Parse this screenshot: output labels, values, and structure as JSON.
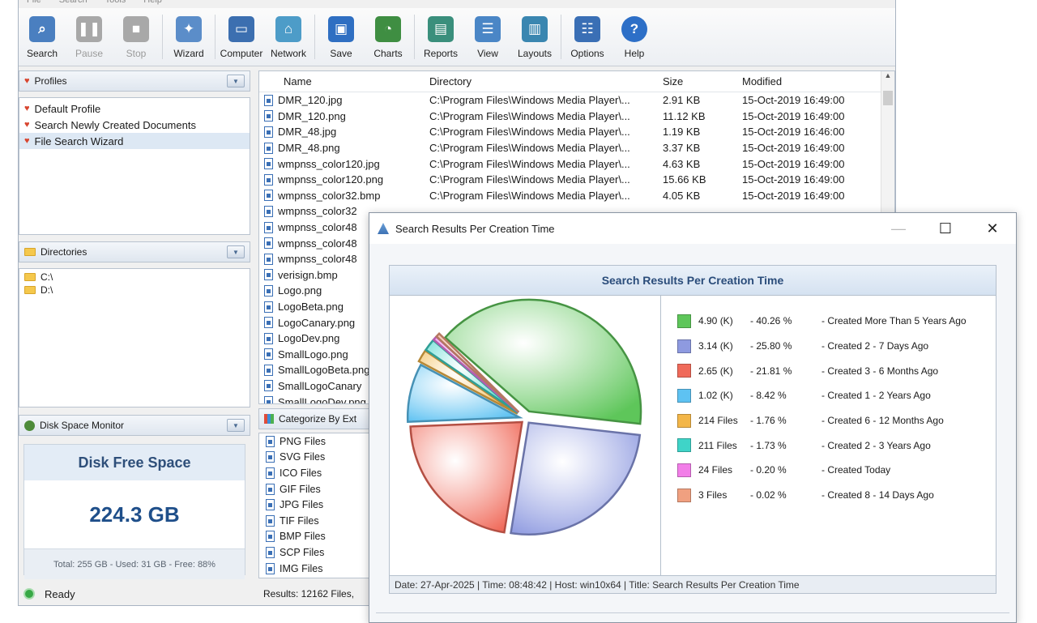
{
  "menu": [
    "File",
    "Search",
    "Tools",
    "Help"
  ],
  "toolbar": [
    {
      "label": "Search",
      "icon": "search-icon",
      "enabled": true
    },
    {
      "label": "Pause",
      "icon": "pause-icon",
      "enabled": false
    },
    {
      "label": "Stop",
      "icon": "stop-icon",
      "enabled": false
    },
    {
      "label": "Wizard",
      "icon": "wizard-icon",
      "enabled": true
    },
    {
      "label": "Computer",
      "icon": "computer-icon",
      "enabled": true
    },
    {
      "label": "Network",
      "icon": "network-icon",
      "enabled": true
    },
    {
      "label": "Save",
      "icon": "save-icon",
      "enabled": true
    },
    {
      "label": "Charts",
      "icon": "charts-icon",
      "enabled": true
    },
    {
      "label": "Reports",
      "icon": "reports-icon",
      "enabled": true
    },
    {
      "label": "View",
      "icon": "view-icon",
      "enabled": true
    },
    {
      "label": "Layouts",
      "icon": "layouts-icon",
      "enabled": true
    },
    {
      "label": "Options",
      "icon": "options-icon",
      "enabled": true
    },
    {
      "label": "Help",
      "icon": "help-icon",
      "enabled": true
    }
  ],
  "profiles": {
    "title": "Profiles",
    "items": [
      {
        "label": "Default Profile",
        "selected": false
      },
      {
        "label": "Search Newly Created Documents",
        "selected": false
      },
      {
        "label": "File Search Wizard",
        "selected": true
      }
    ]
  },
  "directories": {
    "title": "Directories",
    "items": [
      "C:\\",
      "D:\\"
    ]
  },
  "disk": {
    "panel_title": "Disk Space Monitor",
    "title": "Disk Free Space",
    "value": "224.3 GB",
    "footer": "Total: 255 GB - Used: 31 GB - Free: 88%"
  },
  "results": {
    "columns": [
      "Name",
      "Directory",
      "Size",
      "Modified"
    ],
    "rows": [
      [
        "DMR_120.jpg",
        "C:\\Program Files\\Windows Media Player\\...",
        "2.91 KB",
        "15-Oct-2019 16:49:00"
      ],
      [
        "DMR_120.png",
        "C:\\Program Files\\Windows Media Player\\...",
        "11.12 KB",
        "15-Oct-2019 16:49:00"
      ],
      [
        "DMR_48.jpg",
        "C:\\Program Files\\Windows Media Player\\...",
        "1.19 KB",
        "15-Oct-2019 16:46:00"
      ],
      [
        "DMR_48.png",
        "C:\\Program Files\\Windows Media Player\\...",
        "3.37 KB",
        "15-Oct-2019 16:49:00"
      ],
      [
        "wmpnss_color120.jpg",
        "C:\\Program Files\\Windows Media Player\\...",
        "4.63 KB",
        "15-Oct-2019 16:49:00"
      ],
      [
        "wmpnss_color120.png",
        "C:\\Program Files\\Windows Media Player\\...",
        "15.66 KB",
        "15-Oct-2019 16:49:00"
      ],
      [
        "wmpnss_color32.bmp",
        "C:\\Program Files\\Windows Media Player\\...",
        "4.05 KB",
        "15-Oct-2019 16:49:00"
      ],
      [
        "wmpnss_color32",
        "",
        "",
        ""
      ],
      [
        "wmpnss_color48",
        "",
        "",
        ""
      ],
      [
        "wmpnss_color48",
        "",
        "",
        ""
      ],
      [
        "wmpnss_color48",
        "",
        "",
        ""
      ],
      [
        "verisign.bmp",
        "",
        "",
        ""
      ],
      [
        "Logo.png",
        "",
        "",
        ""
      ],
      [
        "LogoBeta.png",
        "",
        "",
        ""
      ],
      [
        "LogoCanary.png",
        "",
        "",
        ""
      ],
      [
        "LogoDev.png",
        "",
        "",
        ""
      ],
      [
        "SmallLogo.png",
        "",
        "",
        ""
      ],
      [
        "SmallLogoBeta.png",
        "",
        "",
        ""
      ],
      [
        "SmallLogoCanary",
        "",
        "",
        ""
      ],
      [
        "SmallLogoDev.png",
        "",
        "",
        ""
      ]
    ]
  },
  "categorize": {
    "title": "Categorize By Ext",
    "items": [
      "PNG Files",
      "SVG Files",
      "ICO Files",
      "GIF Files",
      "JPG Files",
      "TIF Files",
      "BMP Files",
      "SCP Files",
      "IMG Files"
    ]
  },
  "status": {
    "text": "Ready",
    "results": "Results: 12162 Files,"
  },
  "dialog": {
    "title": "Search Results Per Creation Time",
    "minimize": "—",
    "maximize": "☐",
    "close": "✕"
  },
  "chart_data": {
    "type": "pie",
    "title": "Search Results Per Creation Time",
    "slices": [
      {
        "value_label": "4.90 (K)",
        "percent": 40.26,
        "percent_label": "- 40.26 %",
        "label": "- Created More Than 5 Years Ago",
        "color": "#5ec65a"
      },
      {
        "value_label": "3.14 (K)",
        "percent": 25.8,
        "percent_label": "- 25.80 %",
        "label": "- Created 2 - 7 Days Ago",
        "color": "#8e9ae0"
      },
      {
        "value_label": "2.65 (K)",
        "percent": 21.81,
        "percent_label": "- 21.81 %",
        "label": "- Created 3 - 6 Months Ago",
        "color": "#f06a5a"
      },
      {
        "value_label": "1.02 (K)",
        "percent": 8.42,
        "percent_label": "- 8.42 %",
        "label": "- Created 1 - 2 Years Ago",
        "color": "#5ec2f2"
      },
      {
        "value_label": "214 Files",
        "percent": 1.76,
        "percent_label": "- 1.76 %",
        "label": "- Created 6 - 12 Months Ago",
        "color": "#f3b648"
      },
      {
        "value_label": "211 Files",
        "percent": 1.73,
        "percent_label": "- 1.73 %",
        "label": "- Created 2 - 3 Years Ago",
        "color": "#3fd4c8"
      },
      {
        "value_label": "24 Files",
        "percent": 0.2,
        "percent_label": "- 0.20 %",
        "label": "- Created Today",
        "color": "#f27ee8"
      },
      {
        "value_label": "3 Files",
        "percent": 0.02,
        "percent_label": "- 0.02 %",
        "label": "- Created 8 - 14 Days Ago",
        "color": "#f0a080"
      }
    ],
    "footer": "Date: 27-Apr-2025 | Time: 08:48:42 | Host: win10x64 | Title: Search Results Per Creation Time"
  }
}
